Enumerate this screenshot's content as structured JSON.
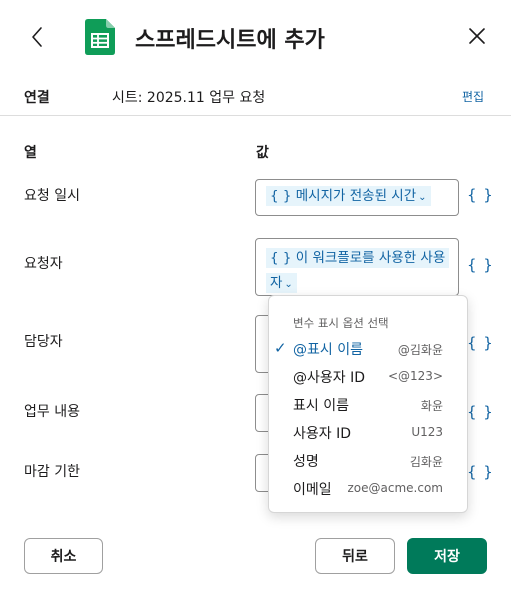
{
  "header": {
    "back_icon": "chevron-left-icon",
    "app_icon": "google-sheets-icon",
    "title": "스프레드시트에 추가",
    "close_icon": "close-icon"
  },
  "connection": {
    "label": "연결",
    "value": "시트: 2025.11 업무 요청",
    "edit_label": "편집"
  },
  "columns": {
    "column_header": "열",
    "value_header": "값"
  },
  "fields": [
    {
      "label": "요청 일시",
      "token": "{ } 메시지가 전송된 시간"
    },
    {
      "label": "요청자",
      "token": "{ } 이 워크플로를 사용한 사용자"
    },
    {
      "label": "담당자"
    },
    {
      "label": "업무 내용"
    },
    {
      "label": "마감 기한"
    }
  ],
  "variable_button_label": "{ }",
  "dropdown": {
    "title": "변수 표시 옵션 선택",
    "check_icon": "checkmark-icon",
    "items": [
      {
        "label": "@표시 이름",
        "example": "@김화윤",
        "selected": true
      },
      {
        "label": "@사용자 ID",
        "example": "<@123>"
      },
      {
        "label": "표시 이름",
        "example": "화윤"
      },
      {
        "label": "사용자 ID",
        "example": "U123"
      },
      {
        "label": "성명",
        "example": "김화윤"
      },
      {
        "label": "이메일",
        "example": "zoe@acme.com"
      }
    ]
  },
  "footer": {
    "cancel_label": "취소",
    "back_label": "뒤로",
    "save_label": "저장"
  },
  "colors": {
    "link": "#1264a3",
    "token_bg": "#e6f4fb",
    "primary_button": "#007a5a",
    "sheets_green": "#0f9d58"
  }
}
